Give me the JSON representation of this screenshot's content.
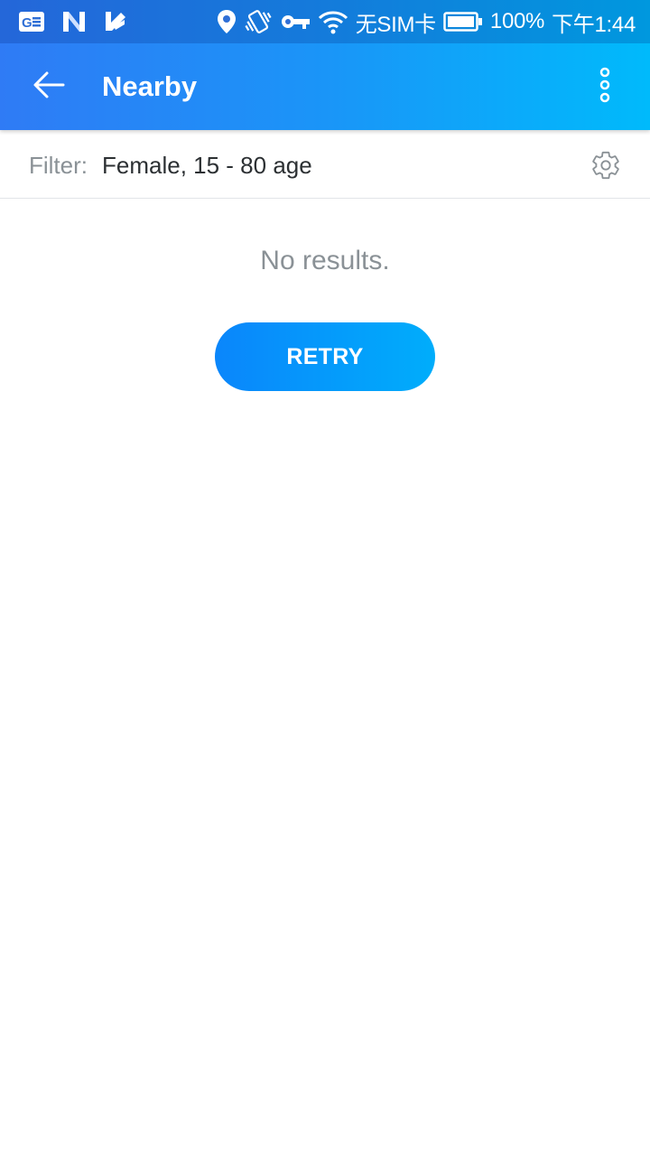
{
  "status_bar": {
    "left_icons": [
      "gmail-like-icon",
      "n-app-icon",
      "checkmark-app-icon"
    ],
    "right_icons": [
      "location-pin-icon",
      "vibrate-icon",
      "vpn-key-icon",
      "wifi-icon"
    ],
    "sim_text": "无SIM卡",
    "battery_icon": "battery-full-icon",
    "battery_text": "100%",
    "time": "下午1:44"
  },
  "toolbar": {
    "back_icon": "arrow-left-icon",
    "title": "Nearby",
    "overflow_icon": "more-vertical-icon"
  },
  "filter": {
    "label": "Filter:",
    "value": "Female, 15 - 80 age",
    "settings_icon": "gear-icon"
  },
  "empty_state": {
    "message": "No results.",
    "retry_label": "RETRY"
  },
  "colors": {
    "header_start": "#2f7bf5",
    "header_end": "#00bafb",
    "button_start": "#0a86fb",
    "button_end": "#00adfb",
    "muted_text": "#8a9196",
    "body_text": "#2c3033"
  }
}
